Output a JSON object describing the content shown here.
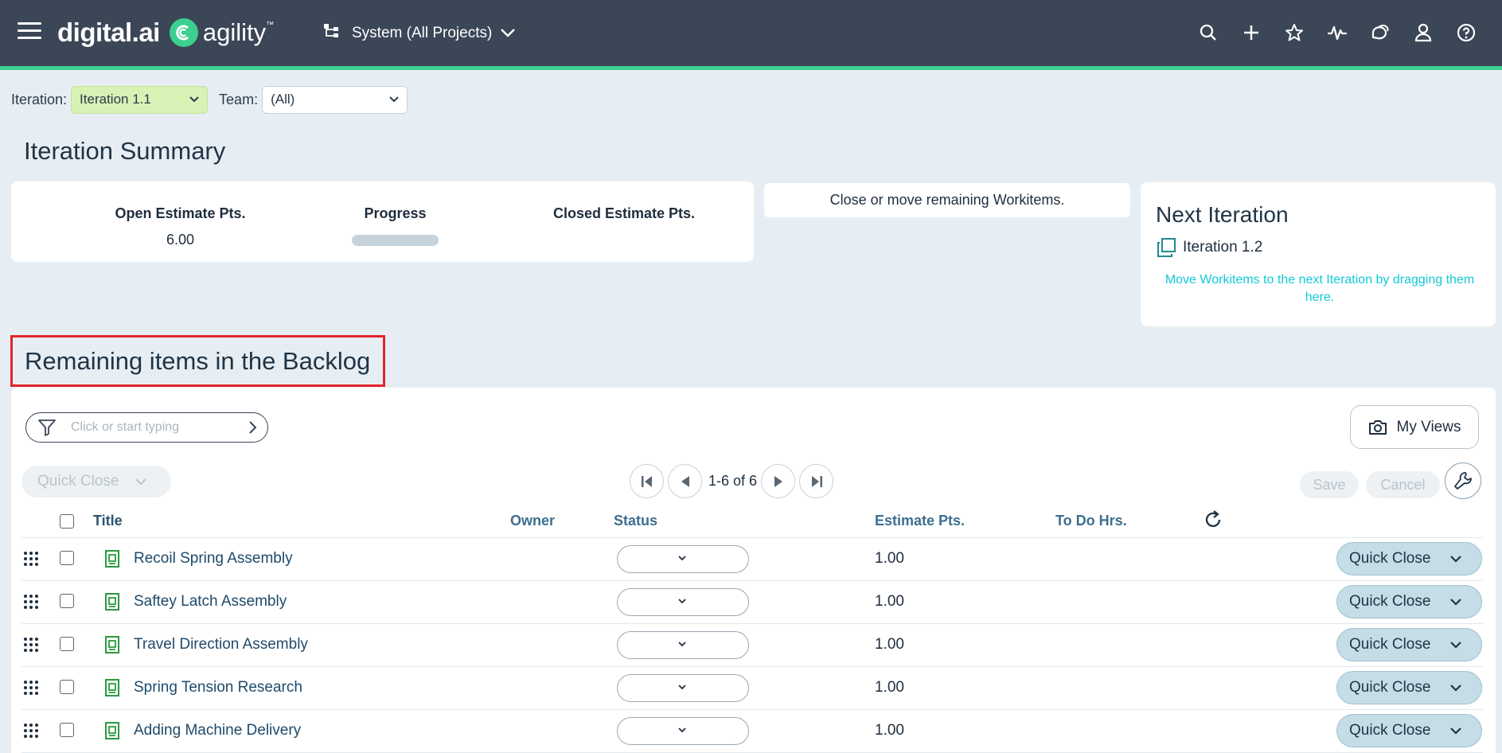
{
  "header": {
    "brand_primary": "digital.ai",
    "brand_product": "agility",
    "brand_tm": "™",
    "project_scope": "System (All Projects)",
    "icons": [
      "search-icon",
      "add-icon",
      "star-icon",
      "activity-icon",
      "conversations-icon",
      "user-icon",
      "help-icon"
    ]
  },
  "filters": {
    "iteration_label": "Iteration:",
    "iteration_value": "Iteration 1.1",
    "team_label": "Team:",
    "team_value": "(All)"
  },
  "summary": {
    "title": "Iteration Summary",
    "open_estimate_label": "Open Estimate Pts.",
    "open_estimate_value": "6.00",
    "progress_label": "Progress",
    "progress_fraction": 0,
    "closed_estimate_label": "Closed Estimate Pts.",
    "closed_estimate_value": "",
    "close_move_text": "Close or move remaining Workitems."
  },
  "next_iteration": {
    "title": "Next Iteration",
    "name": "Iteration 1.2",
    "hint": "Move Workitems to the next Iteration by dragging them here."
  },
  "backlog": {
    "title": "Remaining items in the Backlog",
    "filter_placeholder": "Click or start typing",
    "my_views_label": "My Views",
    "quick_close_label": "Quick Close",
    "pager_text": "1-6 of 6",
    "save_label": "Save",
    "cancel_label": "Cancel",
    "columns": {
      "title": "Title",
      "owner": "Owner",
      "status": "Status",
      "estimate": "Estimate Pts.",
      "todo": "To Do Hrs."
    },
    "rows": [
      {
        "title": "Recoil Spring Assembly",
        "owner": "",
        "status": "",
        "estimate": "1.00",
        "todo": "",
        "action": "Quick Close"
      },
      {
        "title": "Saftey Latch Assembly",
        "owner": "",
        "status": "",
        "estimate": "1.00",
        "todo": "",
        "action": "Quick Close"
      },
      {
        "title": "Travel Direction Assembly",
        "owner": "",
        "status": "",
        "estimate": "1.00",
        "todo": "",
        "action": "Quick Close"
      },
      {
        "title": "Spring Tension Research",
        "owner": "",
        "status": "",
        "estimate": "1.00",
        "todo": "",
        "action": "Quick Close"
      },
      {
        "title": "Adding Machine Delivery",
        "owner": "",
        "status": "",
        "estimate": "1.00",
        "todo": "",
        "action": "Quick Close"
      }
    ]
  },
  "colors": {
    "topbar": "#3b4657",
    "accent": "#3ccf8e",
    "iteration_select": "#d8f2b6",
    "hint_text": "#12c9d8",
    "highlight_box": "#e3242b"
  }
}
